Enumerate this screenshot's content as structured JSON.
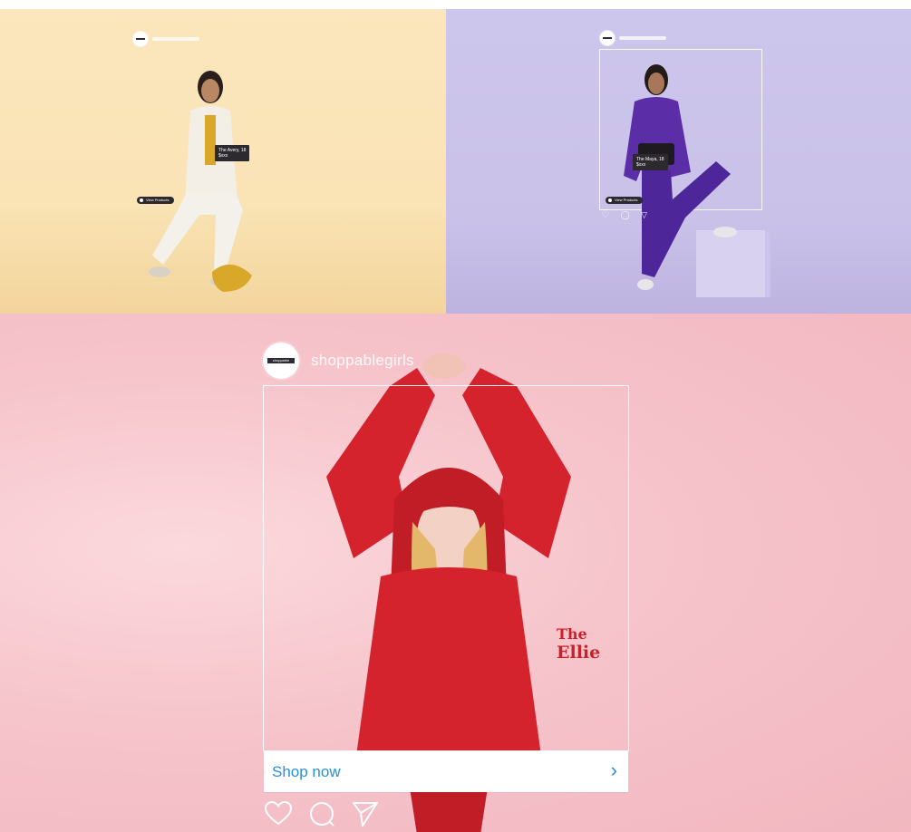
{
  "panels": {
    "yellow": {
      "tag_title": "The Avery, 18",
      "tag_sub": "$xxx",
      "pill_label": "View Products"
    },
    "lavender": {
      "tag_title": "The Maya, 18",
      "tag_sub": "$xxx",
      "pill_label": "View Products",
      "icons": "♡ ◯ ▽"
    }
  },
  "post": {
    "avatar_logo": "shoppable",
    "handle": "shoppablegirls",
    "brand_line1": "The",
    "brand_line2": "Ellie",
    "cta_label": "Shop now",
    "cta_chevron": "›"
  },
  "colors": {
    "yellow_bg": "#fae4b6",
    "lavender_bg": "#c9c1e8",
    "pink_bg": "#f6c4cb",
    "hoodie_red": "#d5232d",
    "cta_blue": "#2a8fd6",
    "brand_red": "#c9202a"
  },
  "icons": [
    "heart-icon",
    "comment-icon",
    "send-icon",
    "chevron-right-icon",
    "bag-icon"
  ]
}
